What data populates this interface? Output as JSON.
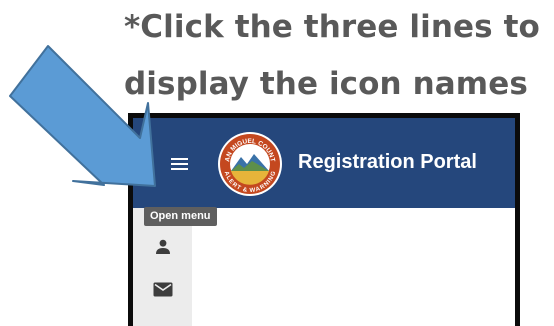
{
  "instruction": {
    "line1": "*Click the three lines to",
    "line2": "display the icon names"
  },
  "app": {
    "title": "Registration Portal",
    "logo": {
      "icon": "county-seal-logo",
      "text_top": "SAN MIGUEL COUNTY",
      "text_bottom": "ALERT & WARNING"
    },
    "menu": {
      "icon": "hamburger-menu-icon",
      "tooltip": "Open menu"
    },
    "nav": [
      {
        "icon": "person-icon"
      },
      {
        "icon": "mail-icon"
      }
    ]
  },
  "colors": {
    "appbar": "#25477c",
    "sidebar": "#ececec",
    "tooltip": "#5f5f5f",
    "arrow_fill": "#5b9bd5",
    "arrow_stroke": "#41719c",
    "instruction_text": "#595959"
  }
}
